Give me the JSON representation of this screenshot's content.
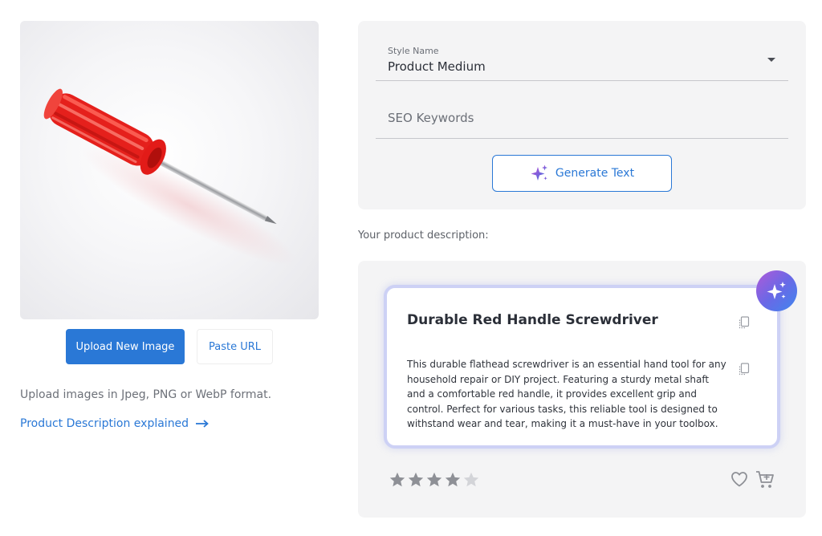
{
  "upload": {
    "upload_button": "Upload New Image",
    "paste_button": "Paste URL",
    "hint": "Upload images in Jpeg, PNG or WebP format.",
    "explained_link": "Product Description explained"
  },
  "form": {
    "style_label": "Style Name",
    "style_value": "Product Medium",
    "seo_placeholder": "SEO Keywords",
    "generate_button": "Generate Text"
  },
  "result": {
    "section_label": "Your product description:",
    "title": "Durable Red Handle Screwdriver",
    "body": "This durable flathead screwdriver is an essential hand tool for any household repair or DIY project. Featuring a sturdy metal shaft and a comfortable red handle, it provides excellent grip and control. Perfect for various tasks, this reliable tool is designed to withstand wear and tear, making it a must-have in your toolbox.",
    "rating": {
      "value": 4,
      "max": 5
    }
  },
  "colors": {
    "accent": "#2a78d6",
    "star_filled": "#8e9096",
    "star_empty": "#d3d4d8",
    "badge_gradient": [
      "#b05ad8",
      "#6a68e6",
      "#3f86ee"
    ]
  },
  "icons": [
    "screwdriver-image",
    "arrow-right-icon",
    "dropdown-caret-icon",
    "sparkle-icon",
    "ai-sparkle-badge-icon",
    "copy-icon",
    "star-icon",
    "heart-icon",
    "cart-icon"
  ]
}
